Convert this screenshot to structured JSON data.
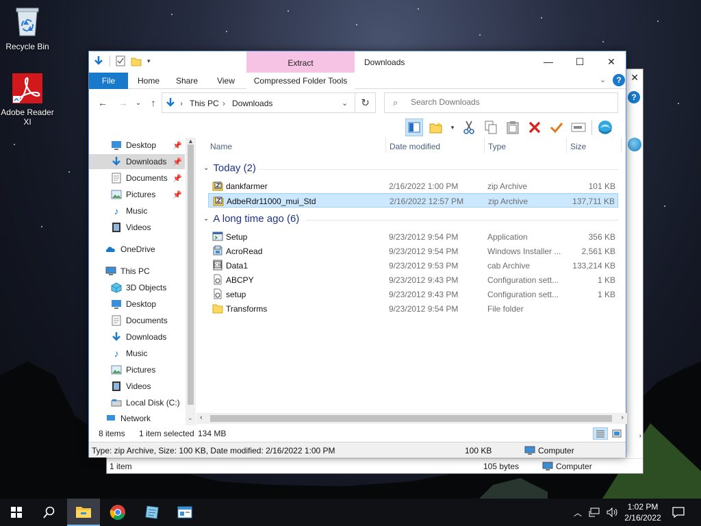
{
  "desktop": {
    "icons": [
      {
        "label": "Recycle Bin",
        "icon": "recycle-bin-icon"
      },
      {
        "label": "Adobe Reader XI",
        "icon": "adobe-reader-icon"
      }
    ]
  },
  "background_window": {
    "status_items": "1 item",
    "status_size": "105 bytes",
    "status_location": "Computer"
  },
  "window": {
    "title": "Downloads",
    "context_tab_group": "Extract",
    "ribbon_tabs": [
      "File",
      "Home",
      "Share",
      "View",
      "Compressed Folder Tools"
    ],
    "address": {
      "crumbs": [
        "This PC",
        "Downloads"
      ]
    },
    "search": {
      "placeholder": "Search Downloads"
    },
    "nav_pane": {
      "quick_access": [
        {
          "label": "Desktop",
          "icon": "desktop-icon",
          "pinned": true
        },
        {
          "label": "Downloads",
          "icon": "downloads-icon",
          "pinned": true,
          "selected": true
        },
        {
          "label": "Documents",
          "icon": "documents-icon",
          "pinned": true
        },
        {
          "label": "Pictures",
          "icon": "pictures-icon",
          "pinned": true
        },
        {
          "label": "Music",
          "icon": "music-icon",
          "pinned": false
        },
        {
          "label": "Videos",
          "icon": "videos-icon",
          "pinned": false
        }
      ],
      "onedrive": "OneDrive",
      "this_pc": "This PC",
      "this_pc_items": [
        {
          "label": "3D Objects",
          "icon": "3d-objects-icon"
        },
        {
          "label": "Desktop",
          "icon": "desktop-icon"
        },
        {
          "label": "Documents",
          "icon": "documents-icon"
        },
        {
          "label": "Downloads",
          "icon": "downloads-icon"
        },
        {
          "label": "Music",
          "icon": "music-icon"
        },
        {
          "label": "Pictures",
          "icon": "pictures-icon"
        },
        {
          "label": "Videos",
          "icon": "videos-icon"
        },
        {
          "label": "Local Disk (C:)",
          "icon": "local-disk-icon"
        }
      ],
      "network": "Network"
    },
    "columns": [
      "Name",
      "Date modified",
      "Type",
      "Size"
    ],
    "groups": [
      {
        "title": "Today (2)",
        "files": [
          {
            "name": "dankfarmer",
            "date": "2/16/2022 1:00 PM",
            "type": "zip Archive",
            "size": "101 KB",
            "icon": "zip-icon",
            "selected": false
          },
          {
            "name": "AdbeRdr11000_mui_Std",
            "date": "2/16/2022 12:57 PM",
            "type": "zip Archive",
            "size": "137,711 KB",
            "icon": "zip-icon",
            "selected": true
          }
        ]
      },
      {
        "title": "A long time ago (6)",
        "files": [
          {
            "name": "Setup",
            "date": "9/23/2012 9:54 PM",
            "type": "Application",
            "size": "356 KB",
            "icon": "application-icon",
            "selected": false
          },
          {
            "name": "AcroRead",
            "date": "9/23/2012 9:54 PM",
            "type": "Windows Installer ...",
            "size": "2,561 KB",
            "icon": "installer-icon",
            "selected": false
          },
          {
            "name": "Data1",
            "date": "9/23/2012 9:53 PM",
            "type": "cab Archive",
            "size": "133,214 KB",
            "icon": "cab-icon",
            "selected": false
          },
          {
            "name": "ABCPY",
            "date": "9/23/2012 9:43 PM",
            "type": "Configuration sett...",
            "size": "1 KB",
            "icon": "config-file-icon",
            "selected": false
          },
          {
            "name": "setup",
            "date": "9/23/2012 9:43 PM",
            "type": "Configuration sett...",
            "size": "1 KB",
            "icon": "config-file-icon",
            "selected": false
          },
          {
            "name": "Transforms",
            "date": "9/23/2012 9:54 PM",
            "type": "File folder",
            "size": "",
            "icon": "folder-icon",
            "selected": false
          }
        ]
      }
    ],
    "status": {
      "count": "8 items",
      "selection": "1 item selected",
      "selection_size": "134 MB"
    },
    "details": {
      "text": "Type: zip Archive, Size: 100 KB, Date modified: 2/16/2022 1:00 PM",
      "size": "100 KB",
      "location": "Computer"
    }
  },
  "taskbar": {
    "time": "1:02 PM",
    "date": "2/16/2022"
  },
  "colors": {
    "accent": "#1979ca",
    "context_tab": "#f6c3e5",
    "selection": "#cce8ff",
    "group_header": "#1e3287"
  }
}
